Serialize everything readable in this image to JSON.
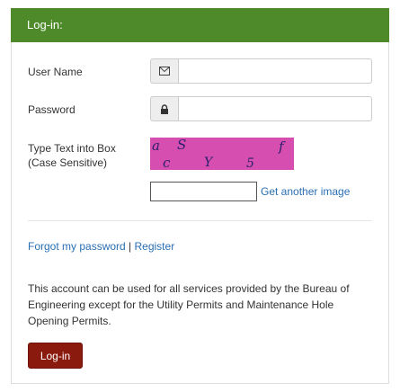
{
  "header": {
    "title": "Log-in:"
  },
  "form": {
    "username": {
      "label": "User Name",
      "icon": "envelope-icon",
      "value": "",
      "placeholder": ""
    },
    "password": {
      "label": "Password",
      "icon": "lock-icon",
      "value": "",
      "placeholder": ""
    },
    "captcha": {
      "label_line1": "Type Text into Box",
      "label_line2": "(Case Sensitive)",
      "image_chars": [
        "a",
        "S",
        "c",
        "Y",
        "5",
        "f"
      ],
      "image_color": "#d64fb0",
      "input_value": "",
      "refresh_link": "Get another image"
    }
  },
  "links": {
    "forgot": "Forgot my password",
    "separator": " | ",
    "register": "Register"
  },
  "notice": "This account can be used for all services provided by the Bureau of Engineering except for the Utility Permits and Maintenance Hole Opening Permits.",
  "actions": {
    "login_label": "Log-in"
  },
  "colors": {
    "header_bg": "#4f8a2a",
    "button_bg": "#8b1a0e",
    "link": "#2a6fb3"
  }
}
